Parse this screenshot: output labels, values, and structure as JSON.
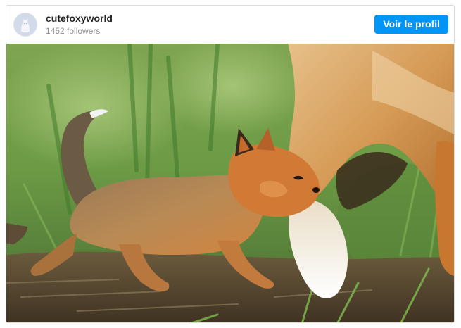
{
  "profile": {
    "username": "cutefoxyworld",
    "followers": "1452 followers",
    "button_label": "Voir le profil"
  },
  "colors": {
    "button": "#0095f6",
    "border": "#dbdbdb"
  },
  "photo": {
    "subject": "fox-kit-and-mother-photo"
  }
}
